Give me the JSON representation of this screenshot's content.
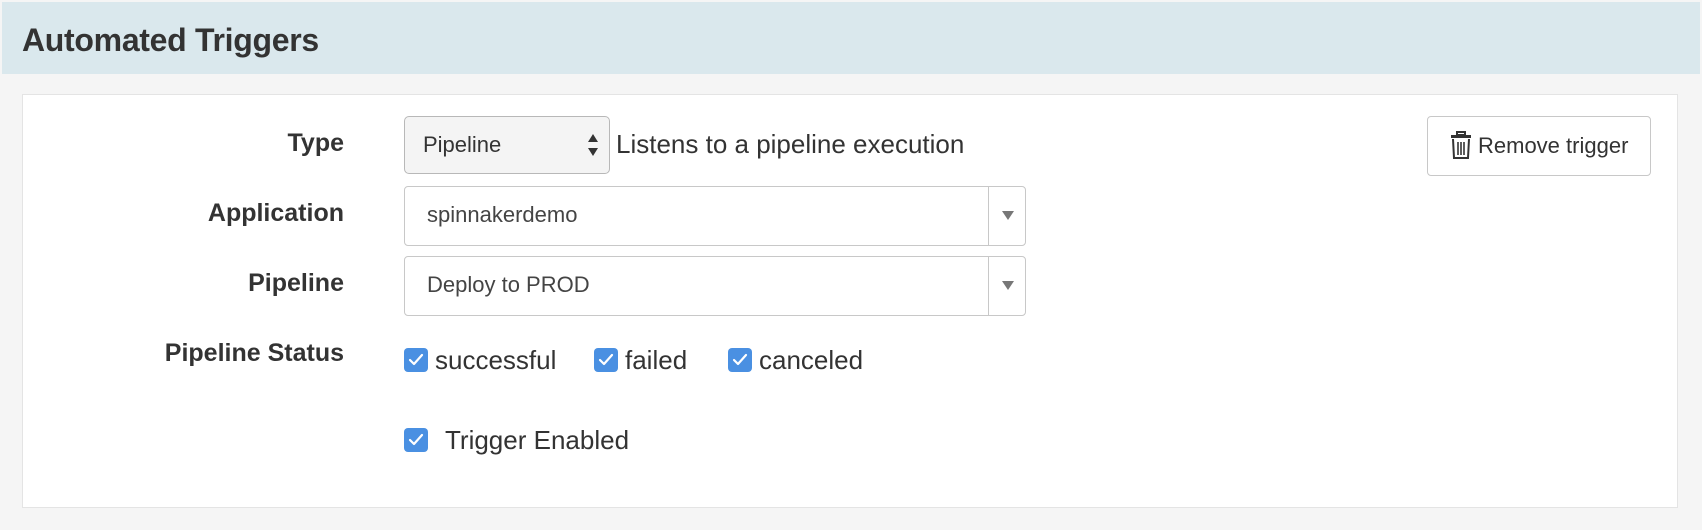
{
  "header": {
    "title": "Automated Triggers"
  },
  "form": {
    "type": {
      "label": "Type",
      "value": "Pipeline",
      "description": "Listens to a pipeline execution"
    },
    "application": {
      "label": "Application",
      "value": "spinnakerdemo"
    },
    "pipeline": {
      "label": "Pipeline",
      "value": "Deploy to PROD"
    },
    "pipeline_status": {
      "label": "Pipeline Status",
      "options": [
        {
          "label": "successful",
          "checked": true
        },
        {
          "label": "failed",
          "checked": true
        },
        {
          "label": "canceled",
          "checked": true
        }
      ]
    },
    "trigger_enabled": {
      "label": "Trigger Enabled",
      "checked": true
    }
  },
  "actions": {
    "remove_label": "Remove trigger",
    "remove_icon": "trash-icon"
  },
  "colors": {
    "header_bg": "#dae8ed",
    "checkbox": "#4a90e2",
    "page_bg": "#f5f5f5"
  }
}
